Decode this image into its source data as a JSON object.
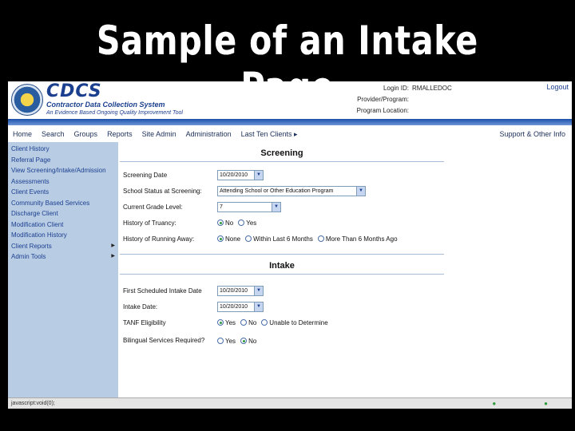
{
  "slide_title": "Sample of an Intake Page",
  "header": {
    "logo_main": "CDCS",
    "logo_sub": "Contractor Data Collection System",
    "logo_tag": "An Evidence Based Ongoing Quality Improvement Tool",
    "login_label": "Login ID:",
    "login_value": "RMALLEDOC",
    "provider_label": "Provider/Program:",
    "location_label": "Program Location:",
    "logout": "Logout"
  },
  "nav": {
    "items": [
      "Home",
      "Search",
      "Groups",
      "Reports",
      "Site Admin",
      "Administration",
      "Last Ten Clients"
    ],
    "right": "Support & Other Info",
    "arrow": "▸"
  },
  "sidebar": {
    "items": [
      {
        "label": "Client History",
        "arrow": ""
      },
      {
        "label": "Referral Page",
        "arrow": ""
      },
      {
        "label": "View Screening/Intake/Admission",
        "arrow": ""
      },
      {
        "label": "Assessments",
        "arrow": ""
      },
      {
        "label": "Client Events",
        "arrow": ""
      },
      {
        "label": "Community Based Services",
        "arrow": ""
      },
      {
        "label": "Discharge Client",
        "arrow": ""
      },
      {
        "label": "Modification Client",
        "arrow": ""
      },
      {
        "label": "Modification History",
        "arrow": ""
      },
      {
        "label": "Client Reports",
        "arrow": "▶"
      },
      {
        "label": "Admin Tools",
        "arrow": "▶"
      }
    ]
  },
  "screening": {
    "title": "Screening",
    "date_label": "Screening Date",
    "date_value": "10/20/2010",
    "school_label": "School Status at Screening:",
    "school_value": "Attending School or Other Education Program",
    "grade_label": "Current Grade Level:",
    "grade_value": "7",
    "truancy_label": "History of Truancy:",
    "truancy_opts": [
      "No",
      "Yes"
    ],
    "running_label": "History of Running Away:",
    "running_opts": [
      "None",
      "Within Last 6 Months",
      "More Than 6 Months Ago"
    ]
  },
  "intake": {
    "title": "Intake",
    "first_label": "First Scheduled Intake Date",
    "first_value": "10/20/2010",
    "intake_label": "Intake Date:",
    "intake_value": "10/20/2010",
    "tanf_label": "TANF Eligibility",
    "tanf_opts": [
      "Yes",
      "No",
      "Unable to Determine"
    ],
    "bilingual_label": "Bilingual Services Required?",
    "bilingual_opts": [
      "Yes",
      "No"
    ]
  },
  "status_bar": {
    "left": "javascript:void(0);"
  }
}
